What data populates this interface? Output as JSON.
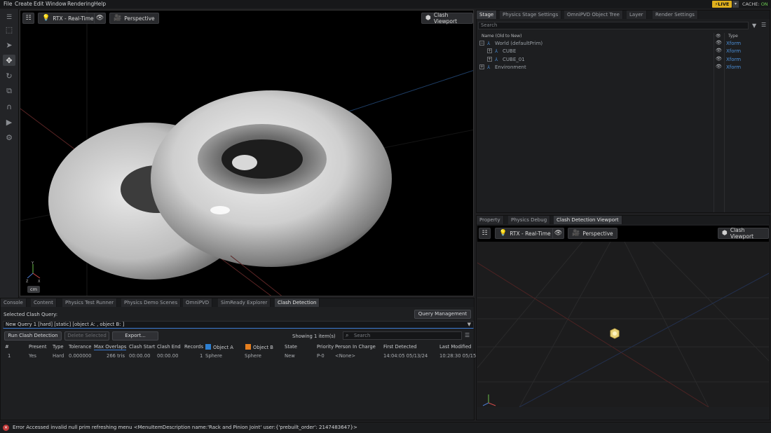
{
  "menu": [
    "File",
    "Create",
    "Edit",
    "Window",
    "Rendering",
    "Help"
  ],
  "live": {
    "label": "LIVE",
    "cache_label": "CACHE:",
    "cache_state": "ON"
  },
  "viewport": {
    "renderer": "RTX - Real-Time",
    "camera": "Perspective",
    "right_button": "Clash Viewport",
    "unit": "cm"
  },
  "bottom": {
    "tabs": [
      "Console",
      "Content",
      "Physics Test Runner",
      "Physics Demo Scenes",
      "OmniPVD",
      "SimReady Explorer",
      "Clash Detection"
    ],
    "selected_query_label": "Selected Clash Query:",
    "query_management": "Query Management",
    "query_value": "New Query 1 [hard] [static] [object A: , object B: ]",
    "run_button": "Run Clash Detection",
    "delete_button": "Delete Selected",
    "export_button": "Export...",
    "showing": "Showing 1 item(s)",
    "search_placeholder": "Search",
    "columns": [
      "#",
      "Present",
      "Type",
      "Tolerance",
      "Max Overlaps",
      "Clash Start",
      "Clash End",
      "Records",
      "Object A",
      "Object B",
      "State",
      "Priority",
      "Person In Charge",
      "First Detected",
      "Last Modified"
    ],
    "row": {
      "num": "1",
      "present": "Yes",
      "type": "Hard",
      "tolerance": "0.000000",
      "max_overlaps": "266  tris",
      "clash_start": "00:00.00",
      "clash_end": "00:00.00",
      "records": "1",
      "object_a": "Sphere",
      "object_b": "Sphere",
      "state": "New",
      "priority": "P-0",
      "person": "<None>",
      "first_detected": "14:04:05 05/13/24",
      "last_modified": "10:28:30 05/15/"
    },
    "object_a_color": "#2d7fd1",
    "object_b_color": "#e57e1e"
  },
  "stage": {
    "tabs": [
      "Stage",
      "Physics Stage Settings",
      "OmniPVD Object Tree",
      "Layer",
      "Render Settings"
    ],
    "search_placeholder": "Search",
    "col_name": "Name (Old to New)",
    "col_type": "Type",
    "items": [
      {
        "label": "World (defaultPrim)",
        "type": "Xform"
      },
      {
        "label": "CUBE",
        "type": "Xform"
      },
      {
        "label": "CUBE_01",
        "type": "Xform"
      },
      {
        "label": "Environment",
        "type": "Xform"
      }
    ]
  },
  "property": {
    "tabs": [
      "Property",
      "Physics Debug",
      "Clash Detection Viewport"
    ],
    "renderer": "RTX - Real-Time",
    "camera": "Perspective",
    "right_button": "Clash Viewport"
  },
  "status": {
    "error": "Error Accessed invalid null prim refreshing menu <MenuItemDescription name:'Rack and Pinion Joint' user:{'prebuilt_order': 2147483647}>"
  }
}
